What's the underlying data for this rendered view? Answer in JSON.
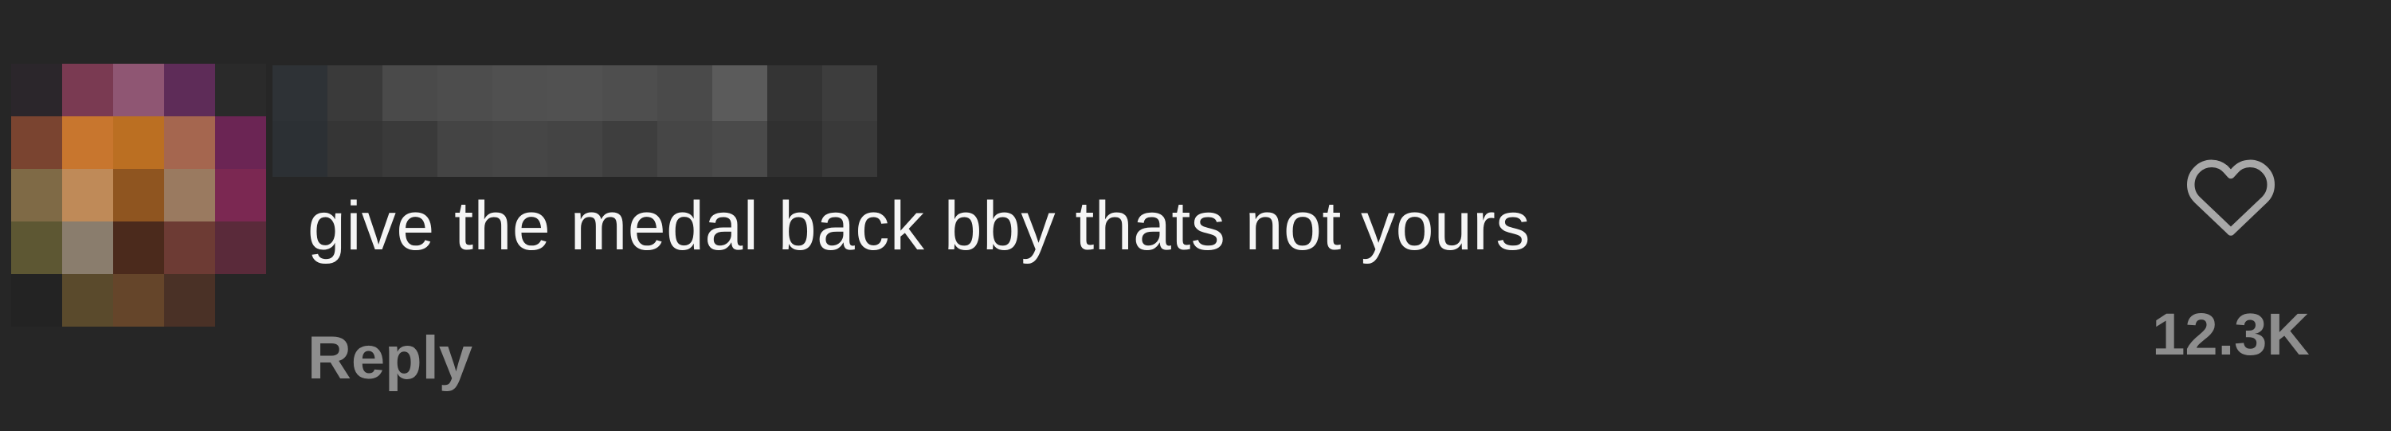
{
  "comment": {
    "username": "",
    "text": "give the medal back bby thats not yours",
    "reply_label": "Reply",
    "like_count": "12.3K",
    "like_icon": "heart-outline-icon",
    "avatar_pixels": [
      "#2b262b",
      "#7a3a52",
      "#8f5673",
      "#5e2c58",
      "#2a2a2a",
      "#7a4430",
      "#c8762e",
      "#bb6f22",
      "#a5664f",
      "#6b2554",
      "#7f6a46",
      "#bf8a58",
      "#8f5520",
      "#9a7a60",
      "#7b2852",
      "#5d5733",
      "#8a7d6d",
      "#4b2a1c",
      "#6d3b34",
      "#5a2a3a",
      "#232323",
      "#5a4a2c",
      "#65452a",
      "#4a3126",
      "#262626"
    ],
    "username_pixels": [
      "#2e3236",
      "#3a3a3a",
      "#4a4a4a",
      "#4d4d4d",
      "#505050",
      "#515151",
      "#4e4e4e",
      "#4a4a4a",
      "#5b5b5b",
      "#343434",
      "#3d3d3d",
      "#2c3034",
      "#353535",
      "#3a3a3a",
      "#444444",
      "#464646",
      "#444444",
      "#3e3e3e",
      "#464646",
      "#4a4a4a",
      "#303030",
      "#393939"
    ]
  }
}
